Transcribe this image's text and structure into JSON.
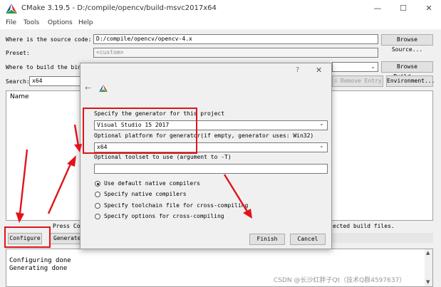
{
  "window": {
    "title": "CMake 3.19.5 - D:/compile/opencv/build-msvc2017x64",
    "minimize": "—",
    "maximize": "☐",
    "close": "✕"
  },
  "menu": [
    "File",
    "Tools",
    "Options",
    "Help"
  ],
  "source": {
    "label": "Where is the source code:",
    "value": "D:/compile/opencv/opencv-4.x",
    "browse": "Browse Source..."
  },
  "preset": {
    "label": "Preset:",
    "value": "<custom>"
  },
  "build": {
    "label": "Where to build the binari",
    "browse": "Browse Build..."
  },
  "search": {
    "label": "Search:",
    "value": "x64",
    "remove": "Remove Entry",
    "environment": "Environment..."
  },
  "table": {
    "name_header": "Name"
  },
  "hint": {
    "left": "Press Con",
    "right": "ected build files."
  },
  "actions": {
    "configure": "Configure",
    "generate": "Generate"
  },
  "log": [
    "Configuring done",
    "Generating done"
  ],
  "watermark": "CSDN @长沙红胖子Qt（技术Q群4597637）",
  "dialog": {
    "help": "?",
    "close": "✕",
    "back": "←",
    "generator_label": "Specify the generator for this project",
    "generator_value": "Visual Studio 15 2017",
    "platform_label": "Optional platform for generator(if empty, generator uses: Win32)",
    "platform_value": "x64",
    "toolset_label": "Optional toolset to use (argument to -T)",
    "toolset_value": "",
    "options": [
      "Use default native compilers",
      "Specify native compilers",
      "Specify toolchain file for cross-compiling",
      "Specify options for cross-compiling"
    ],
    "selected_option": 0,
    "finish": "Finish",
    "cancel": "Cancel"
  },
  "colors": {
    "annotation_red": "#e0141a",
    "cmake_red": "#d62a2a",
    "cmake_blue": "#1a4ea0",
    "cmake_green": "#2e9a3e"
  }
}
